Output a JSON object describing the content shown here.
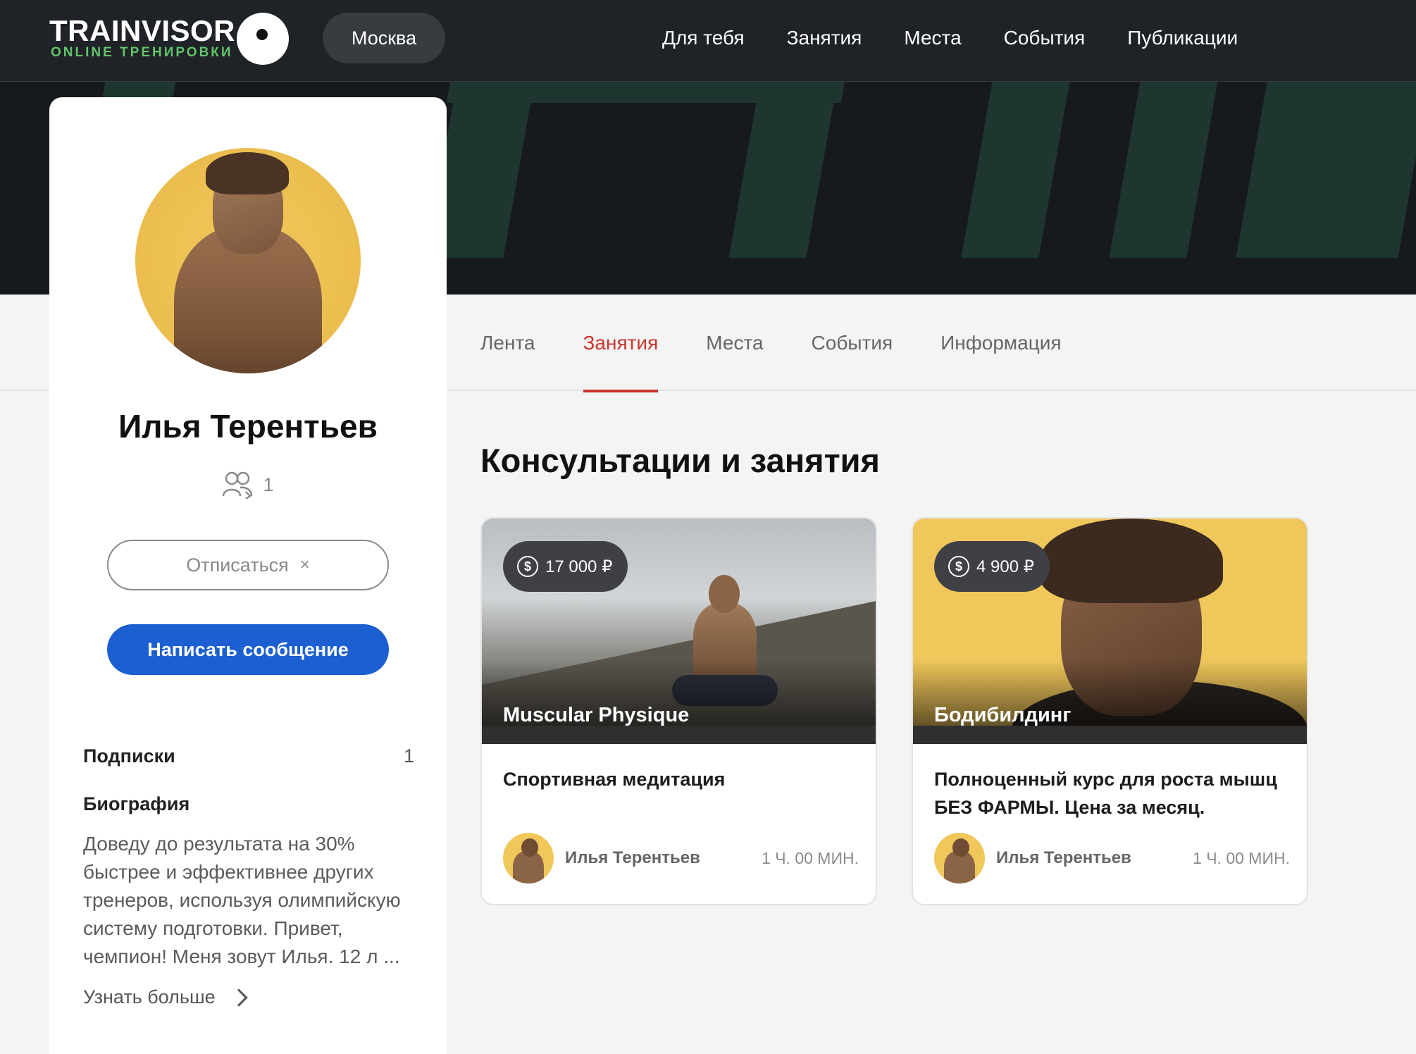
{
  "header": {
    "logo_title": "TRAINVISOR",
    "logo_subtitle": "ONLINE ТРЕНИРОВКИ",
    "city": "Москва",
    "nav": [
      "Для тебя",
      "Занятия",
      "Места",
      "События",
      "Публикации"
    ]
  },
  "profile": {
    "name": "Илья Терентьев",
    "followers": "1",
    "unsubscribe_label": "Отписаться",
    "unsubscribe_icon": "×",
    "message_label": "Написать сообщение",
    "subscriptions_label": "Подписки",
    "subscriptions_count": "1",
    "bio_title": "Биография",
    "bio_text": "Доведу до результата на 30% быстрее и эффективнее других тренеров, используя олимпийскую систему подготовки.   Привет, чемпион!  Меня зовут Илья. 12 л ...",
    "more_label": "Узнать больше"
  },
  "tabs": [
    {
      "label": "Лента",
      "active": false
    },
    {
      "label": "Занятия",
      "active": true
    },
    {
      "label": "Места",
      "active": false
    },
    {
      "label": "События",
      "active": false
    },
    {
      "label": "Информация",
      "active": false
    }
  ],
  "main": {
    "section_title": "Консультации и занятия",
    "cards": [
      {
        "price": "17 000 ₽",
        "category": "Muscular Physique",
        "title": "Спортивная медитация",
        "author": "Илья Терентьев",
        "duration": "1 Ч. 00 МИН."
      },
      {
        "price": "4 900 ₽",
        "category": "Бодибилдинг",
        "title": "Полноценный курс для роста мышц БЕЗ ФАРМЫ. Цена за месяц.",
        "author": "Илья Терентьев",
        "duration": "1 Ч. 00 МИН."
      }
    ]
  },
  "colors": {
    "accent_red": "#c8352d",
    "primary_blue": "#1c5fd1",
    "logo_green": "#63c46a",
    "header_bg": "#1f2227"
  }
}
